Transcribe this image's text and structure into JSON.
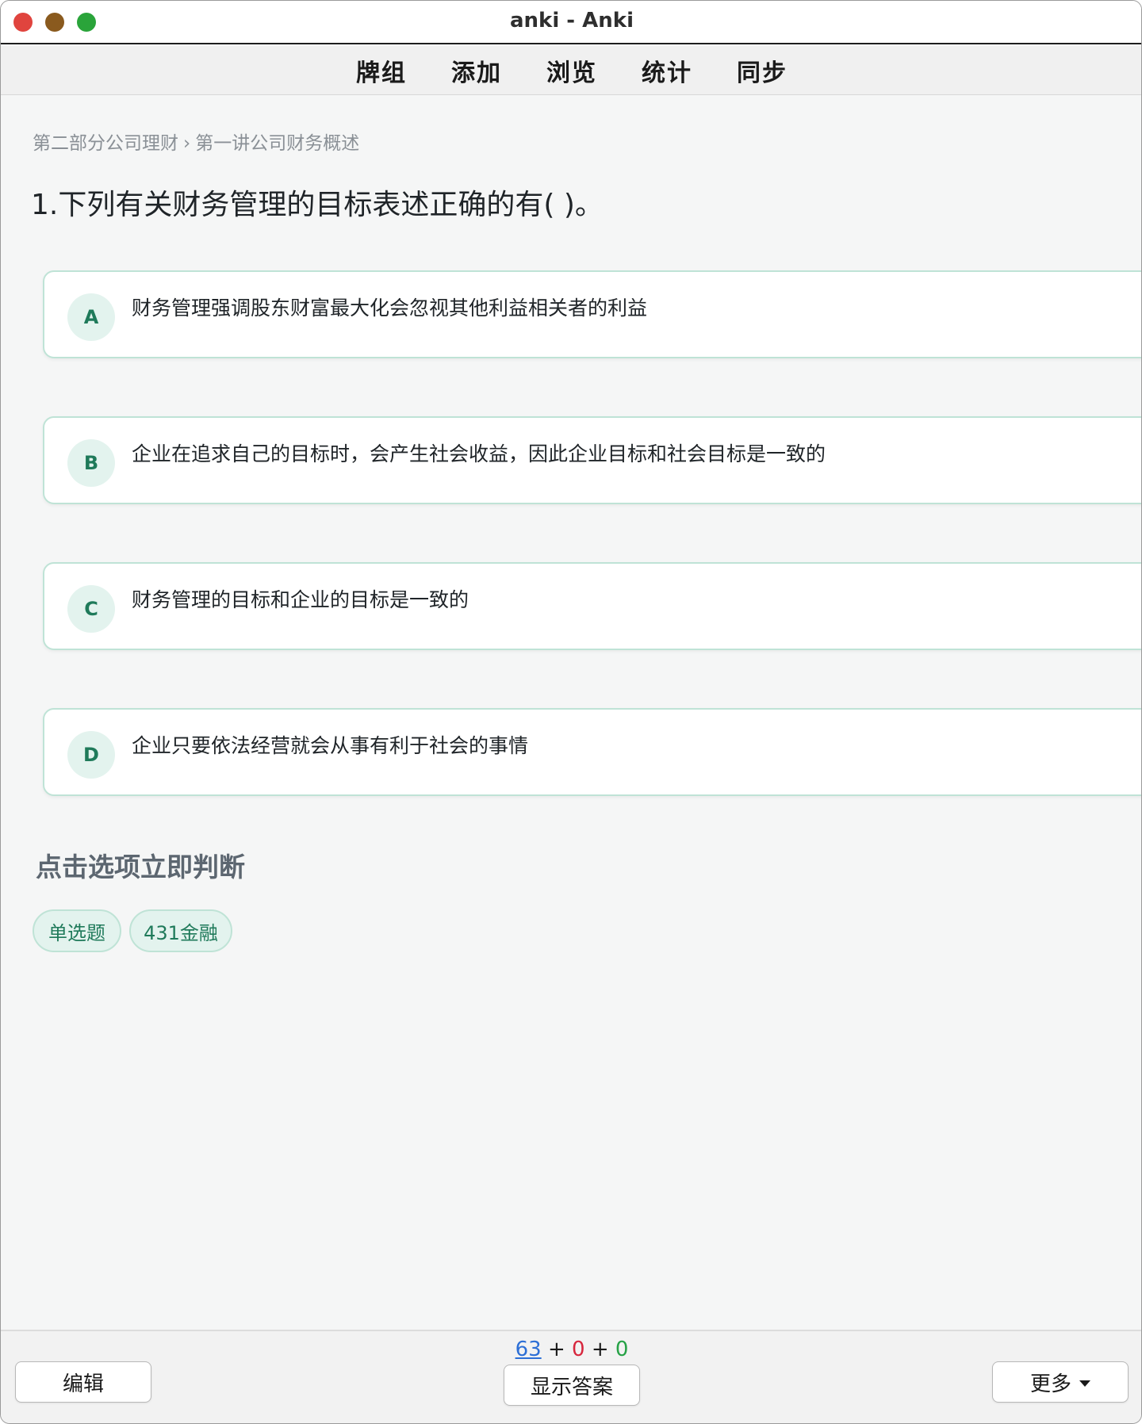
{
  "window": {
    "title": "anki - Anki",
    "colors": {
      "close": "#e0443e",
      "minimize": "#8a5a1e",
      "maximize": "#2aa43a"
    }
  },
  "menu": {
    "items": [
      {
        "label": "牌组"
      },
      {
        "label": "添加"
      },
      {
        "label": "浏览"
      },
      {
        "label": "统计"
      },
      {
        "label": "同步"
      }
    ]
  },
  "card": {
    "breadcrumb": {
      "part1": "第二部分公司理财",
      "separator": "›",
      "part2": "第一讲公司财务概述"
    },
    "question": "1.下列有关财务管理的目标表述正确的有( )。",
    "options": [
      {
        "letter": "A",
        "text": "财务管理强调股东财富最大化会忽视其他利益相关者的利益"
      },
      {
        "letter": "B",
        "text": "企业在追求自己的目标时，会产生社会收益，因此企业目标和社会目标是一致的"
      },
      {
        "letter": "C",
        "text": "财务管理的目标和企业的目标是一致的"
      },
      {
        "letter": "D",
        "text": "企业只要依法经营就会从事有利于社会的事情"
      }
    ],
    "hint": "点击选项立即判断",
    "tags": [
      "单选题",
      "431金融"
    ],
    "accent_color": "#1f7a5a"
  },
  "bottom": {
    "counts": {
      "new": "63",
      "plus1": "+",
      "learn": "0",
      "plus2": "+",
      "review": "0"
    },
    "edit_label": "编辑",
    "show_answer_label": "显示答案",
    "more_label": "更多"
  }
}
